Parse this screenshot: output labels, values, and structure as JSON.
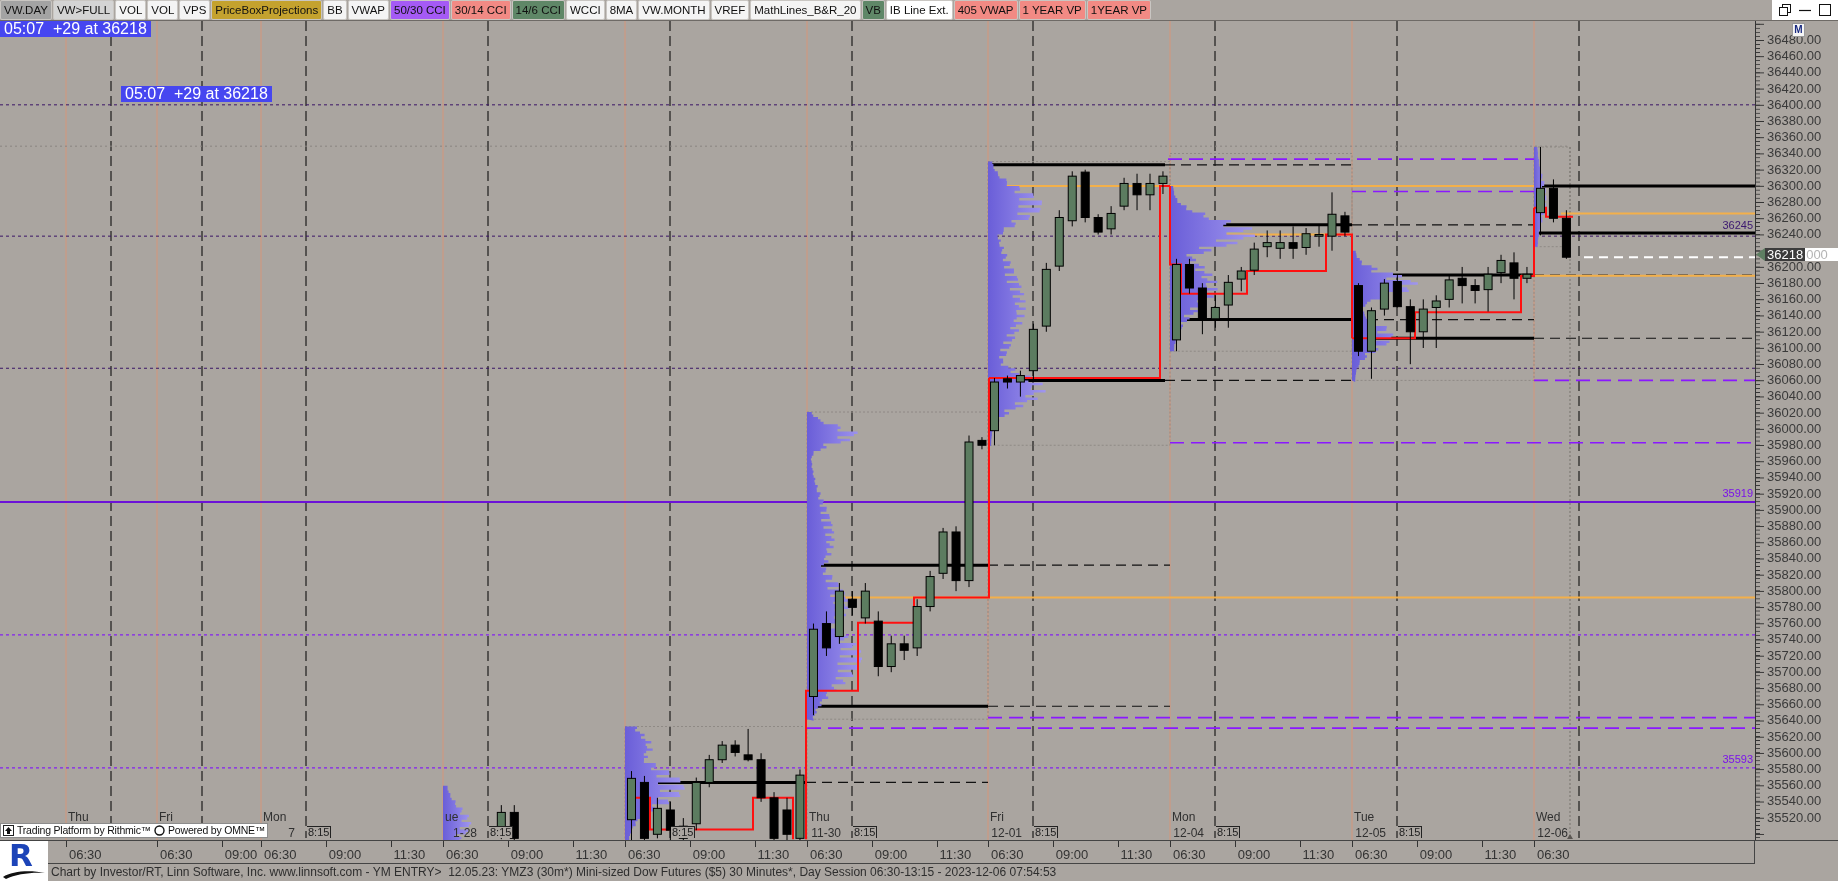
{
  "indicator_tabs": [
    {
      "label": "VW.DAY",
      "color": "#a3a3a3"
    },
    {
      "label": "VW>FULL",
      "color": "#d4d4d4"
    },
    {
      "label": "VOL",
      "color": "#f4f4f4"
    },
    {
      "label": "VOL",
      "color": "#f4f4f4"
    },
    {
      "label": "VPS",
      "color": "#f4f4f4"
    },
    {
      "label": "PriceBoxProjections",
      "color": "#c4a22e"
    },
    {
      "label": "BB",
      "color": "#f4f4f4"
    },
    {
      "label": "VWAP",
      "color": "#f4f4f4"
    },
    {
      "label": "50/30 CCI",
      "color": "#a55af5"
    },
    {
      "label": "30/14 CCI",
      "color": "#f28a84"
    },
    {
      "label": "14/6 CCI",
      "color": "#5f8767"
    },
    {
      "label": "WCCI",
      "color": "#f4f4f4"
    },
    {
      "label": "8MA",
      "color": "#f4f4f4"
    },
    {
      "label": "VW.MONTH",
      "color": "#f4f4f4"
    },
    {
      "label": "VREF",
      "color": "#f4f4f4"
    },
    {
      "label": "MathLines_B&R_20",
      "color": "#f4f4f4"
    },
    {
      "label": "VB",
      "color": "#5f8767"
    },
    {
      "label": "IB Line Ext.",
      "color": "#ffffff"
    },
    {
      "label": "405 VWAP",
      "color": "#f28a84"
    },
    {
      "label": "1 YEAR VP",
      "color": "#f28a84"
    },
    {
      "label": "1YEAR VP",
      "color": "#f28a84"
    }
  ],
  "chart": {
    "alerts": [
      "05:07  +29 at 36218",
      "05:07  +29 at 36218"
    ],
    "level_labels": [
      {
        "text": "36245",
        "color": "#3c1870"
      },
      {
        "text": "35919",
        "color": "#7a12ea"
      },
      {
        "text": "35593",
        "color": "#7a12ea"
      }
    ],
    "sessions": [
      {
        "weekday": "Thu",
        "times": [
          "06:30"
        ]
      },
      {
        "weekday": "Fri",
        "times": [
          "06:30",
          "09:00"
        ]
      },
      {
        "weekday": "Mon",
        "date": "7",
        "ib_label": "8:15",
        "times": [
          "06:30",
          "09:00",
          "11:30"
        ]
      },
      {
        "weekday": "ue",
        "date": "1-28",
        "ib_label": "8:15",
        "times": [
          "06:30",
          "09:00",
          "11:30"
        ]
      },
      {
        "ib_label": "8:15",
        "times": [
          "06:30",
          "09:00",
          "11:30"
        ]
      },
      {
        "weekday": "Thu",
        "date": "11-30",
        "ib_label": "8:15",
        "times": [
          "06:30",
          "09:00",
          "11:30"
        ]
      },
      {
        "weekday": "Fri",
        "date": "12-01",
        "ib_label": "8:15",
        "times": [
          "06:30",
          "09:00",
          "11:30"
        ]
      },
      {
        "weekday": "Mon",
        "date": "12-04",
        "ib_label": "8:15",
        "times": [
          "06:30",
          "09:00",
          "11:30"
        ]
      },
      {
        "weekday": "Tue",
        "date": "12-05",
        "ib_label": "8:15",
        "times": [
          "06:30",
          "09:00",
          "11:30"
        ]
      },
      {
        "weekday": "Wed",
        "date": "12-06",
        "times": [
          "06:30"
        ]
      }
    ]
  },
  "platform_badge": {
    "texts": [
      "Trading Platform by Rithmic™",
      "Powered by OMNE™"
    ]
  },
  "price_axis": {
    "mode_button": "M",
    "rows": [
      {
        "kind": "label",
        "text": "36480.00"
      },
      {
        "kind": "label",
        "text": "36460.00"
      },
      {
        "kind": "label",
        "text": "36440.00"
      },
      {
        "kind": "label",
        "text": "36420.00"
      },
      {
        "kind": "label",
        "text": "36400.00"
      },
      {
        "kind": "label",
        "text": "36380.00"
      },
      {
        "kind": "label",
        "text": "36360.00"
      },
      {
        "kind": "label",
        "text": "36340.00"
      },
      {
        "kind": "label",
        "text": "36320.00"
      },
      {
        "kind": "label",
        "text": "36300.00"
      },
      {
        "kind": "label",
        "text": "36280.00"
      },
      {
        "kind": "label",
        "text": "36260.00"
      },
      {
        "kind": "label",
        "text": "36240.00"
      },
      {
        "kind": "marker",
        "value": "36218",
        "tail": "000"
      },
      {
        "kind": "label",
        "text": "36200.00"
      },
      {
        "kind": "label",
        "text": "36180.00"
      },
      {
        "kind": "label",
        "text": "36160.00"
      },
      {
        "kind": "label",
        "text": "36140.00"
      },
      {
        "kind": "label",
        "text": "36120.00"
      },
      {
        "kind": "label",
        "text": "36100.00"
      },
      {
        "kind": "label",
        "text": "36080.00"
      },
      {
        "kind": "label",
        "text": "36060.00"
      },
      {
        "kind": "label",
        "text": "36040.00"
      },
      {
        "kind": "label",
        "text": "36020.00"
      },
      {
        "kind": "label",
        "text": "36000.00"
      },
      {
        "kind": "label",
        "text": "35980.00"
      },
      {
        "kind": "label",
        "text": "35960.00"
      },
      {
        "kind": "label",
        "text": "35940.00"
      },
      {
        "kind": "label",
        "text": "35920.00"
      },
      {
        "kind": "label",
        "text": "35900.00"
      },
      {
        "kind": "label",
        "text": "35880.00"
      },
      {
        "kind": "label",
        "text": "35860.00"
      },
      {
        "kind": "label",
        "text": "35840.00"
      },
      {
        "kind": "label",
        "text": "35820.00"
      },
      {
        "kind": "label",
        "text": "35800.00"
      },
      {
        "kind": "label",
        "text": "35780.00"
      },
      {
        "kind": "label",
        "text": "35760.00"
      },
      {
        "kind": "label",
        "text": "35740.00"
      },
      {
        "kind": "label",
        "text": "35720.00"
      },
      {
        "kind": "label",
        "text": "35700.00"
      },
      {
        "kind": "label",
        "text": "35680.00"
      },
      {
        "kind": "label",
        "text": "35660.00"
      },
      {
        "kind": "label",
        "text": "35640.00"
      },
      {
        "kind": "label",
        "text": "35620.00"
      },
      {
        "kind": "label",
        "text": "35600.00"
      },
      {
        "kind": "label",
        "text": "35580.00"
      },
      {
        "kind": "label",
        "text": "35560.00"
      },
      {
        "kind": "label",
        "text": "35540.00"
      },
      {
        "kind": "label",
        "text": "35520.00"
      }
    ]
  },
  "logo": {
    "letter": "R"
  },
  "status_bar": "Chart by Investor/RT, Linn Software, Inc. www.linnsoft.com - YM ENTRY>  12.05.23: YMZ3 (30m*) Mini-sized Dow Futures ($5) 30 Minutes*, Day Session 06:30-13:15 - 2023-12-06 07:54:53"
}
